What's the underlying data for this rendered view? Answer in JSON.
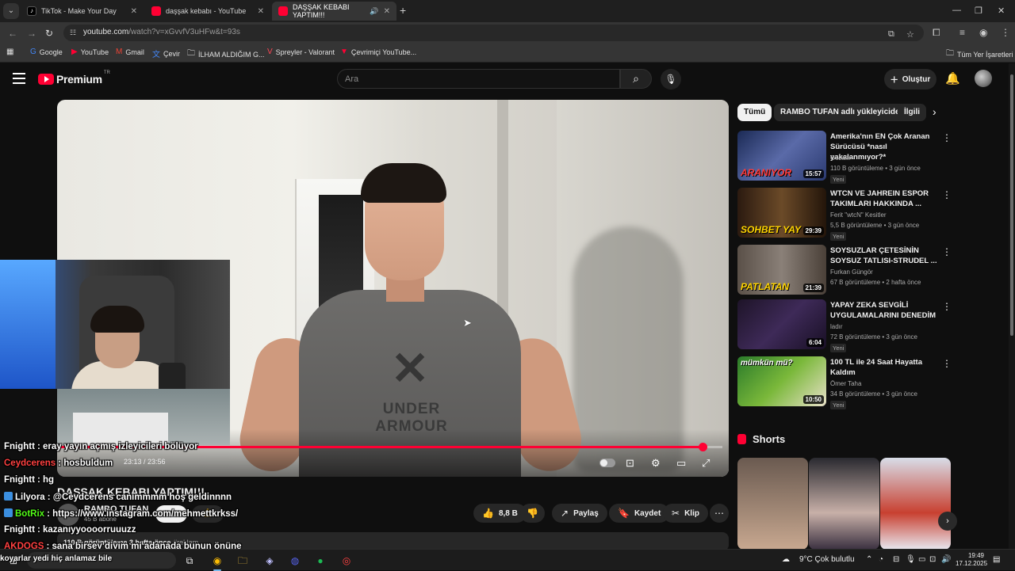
{
  "browser": {
    "tabs": [
      {
        "title": "TikTok - Make Your Day",
        "active": false
      },
      {
        "title": "daşşak kebabı - YouTube",
        "active": false
      },
      {
        "title": "DAŞŞAK KEBABI YAPTIM!!!",
        "active": true
      }
    ],
    "url_host": "youtube.com",
    "url_path": "/watch?v=xGvvfV3uHFw&t=93s",
    "bookmarks": [
      "Google",
      "YouTube",
      "Gmail",
      "Çevir",
      "İLHAM ALDIĞIM G...",
      "Spreyler - Valorant",
      "Çevrimiçi YouTube..."
    ],
    "all_bookmarks": "Tüm Yer İşaretleri"
  },
  "youtube": {
    "logo_text": "Premium",
    "logo_region": "TR",
    "search_placeholder": "Ara",
    "create_label": "Oluştur"
  },
  "player": {
    "time": "23:13 / 23:56",
    "progress_fraction": 0.97
  },
  "video": {
    "title": "DAŞŞAK KEBABI YAPTIM!!!",
    "channel": "RAMBO TUFAN",
    "subscribers": "45 B abone",
    "likes": "8,8 B",
    "share_label": "Paylaş",
    "save_label": "Kaydet",
    "clip_label": "Klip",
    "views": "110 B görüntüleme",
    "age": "3 hafta önce",
    "tag": "#reklam"
  },
  "chat": [
    {
      "user": "Fnightt",
      "text": "eray yayın açmış izleyicileri bölüyor",
      "color": "#ffffff"
    },
    {
      "user": "Ceydcerens",
      "text": "hosbuldum",
      "color": "#ff4040"
    },
    {
      "user": "Fnightt",
      "text": "hg",
      "color": "#ffffff"
    },
    {
      "user": "Lilyora",
      "text": "@Ceydcerens canımmmm hoş geldinnnn",
      "color": "#ffffff",
      "badge": "#3b8fe0"
    },
    {
      "user": "BotRix",
      "text": "https://www.instagram.com/mehmettkrkss/",
      "color": "#53fc18",
      "badge": "#3b8fe0"
    },
    {
      "user": "Fnightt",
      "text": "kazanıyyoooorruuuzz",
      "color": "#ffffff"
    },
    {
      "user": "AKDOGS",
      "text": "sana birşey diyim mi adanada bunun önüne",
      "color": "#ff4040"
    }
  ],
  "overlay_bottom": "koyarlar yedi hiç anlamaz bile",
  "sidebar": {
    "chips": [
      "Tümü",
      "RAMBO TUFAN adlı yükleyiciden",
      "İlgili"
    ],
    "recommendations": [
      {
        "title": "Amerika'nın EN Çok Aranan Sürücüsü *nasıl yakalanmıyor?*",
        "channel": "Gözaltı",
        "views": "110 B görüntüleme • 3 gün önce",
        "badge": "Yeni",
        "duration": "15:57",
        "caption": "ARANIYOR"
      },
      {
        "title": "WTCN VE JAHREIN ESPOR TAKIMLARI HAKKINDA ...",
        "channel": "Ferit \"wtcN\" Kesitler",
        "views": "5,5 B görüntüleme • 3 gün önce",
        "badge": "Yeni",
        "duration": "29:39",
        "caption": "SOHBET YAY"
      },
      {
        "title": "SOYSUZLAR ÇETESİNİN SOYSUZ TATLISI-STRUDEL ...",
        "channel": "Furkan Güngör",
        "views": "67 B görüntüleme • 2 hafta önce",
        "badge": "",
        "duration": "21:39",
        "caption": "PATLATAN"
      },
      {
        "title": "YAPAY ZEKA SEVGİLİ UYGULAMALARINI DENEDİM",
        "channel": "ladır",
        "views": "72 B görüntüleme • 3 gün önce",
        "badge": "Yeni",
        "duration": "6:04",
        "caption": ""
      },
      {
        "title": "100 TL ile 24 Saat Hayatta Kaldım",
        "channel": "Ömer Taha",
        "views": "34 B görüntüleme • 3 gün önce",
        "badge": "Yeni",
        "duration": "10:50",
        "caption": "mümkün mü?"
      }
    ],
    "shorts_title": "Shorts"
  },
  "taskbar": {
    "weather": "9°C  Çok bulutlu",
    "time": "19:49",
    "date": "17.12.2025"
  }
}
